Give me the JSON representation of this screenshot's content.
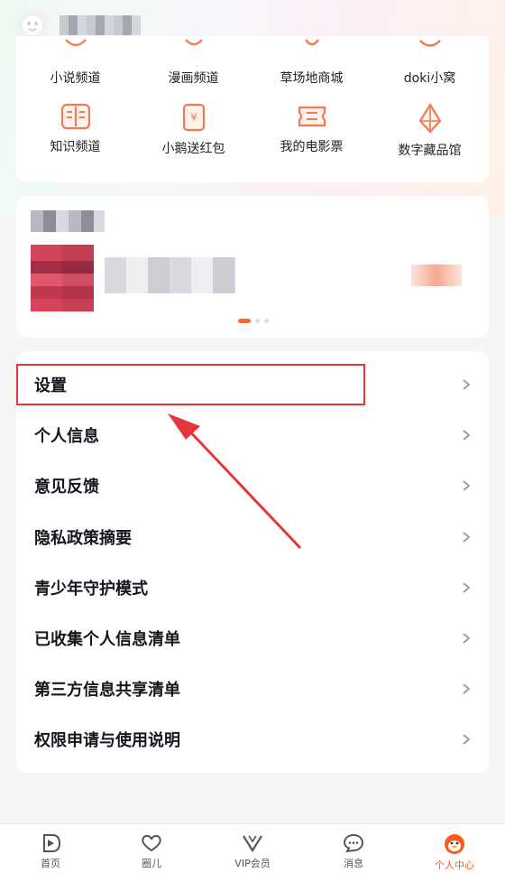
{
  "user": {
    "name_blurred": true
  },
  "quick_grid": {
    "row1": [
      {
        "label": "小说频道",
        "icon": "book-icon"
      },
      {
        "label": "漫画频道",
        "icon": "comic-icon"
      },
      {
        "label": "草场地商城",
        "icon": "shop-icon"
      },
      {
        "label": "doki小窝",
        "icon": "doki-icon"
      }
    ],
    "row2": [
      {
        "label": "知识频道",
        "icon": "knowledge-book-icon"
      },
      {
        "label": "小鹅送红包",
        "icon": "red-packet-icon"
      },
      {
        "label": "我的电影票",
        "icon": "ticket-icon"
      },
      {
        "label": "数字藏品馆",
        "icon": "diamond-crystal-icon"
      }
    ]
  },
  "banner": {
    "dots": 3,
    "active_dot": 0
  },
  "menu": {
    "items": [
      "设置",
      "个人信息",
      "意见反馈",
      "隐私政策摘要",
      "青少年守护模式",
      "已收集个人信息清单",
      "第三方信息共享清单",
      "权限申请与使用说明"
    ]
  },
  "tabbar": {
    "tabs": [
      {
        "label": "首页",
        "icon": "home-play-icon"
      },
      {
        "label": "圈儿",
        "icon": "heart-chat-icon"
      },
      {
        "label": "VIP会员",
        "icon": "vip-v-icon"
      },
      {
        "label": "消息",
        "icon": "message-bubble-icon"
      },
      {
        "label": "个人中心",
        "icon": "profile-penguin-icon",
        "active": true
      }
    ]
  },
  "colors": {
    "accent": "#ff5a1f",
    "highlight": "#e5373b",
    "icon_orange": "#f07a52"
  }
}
